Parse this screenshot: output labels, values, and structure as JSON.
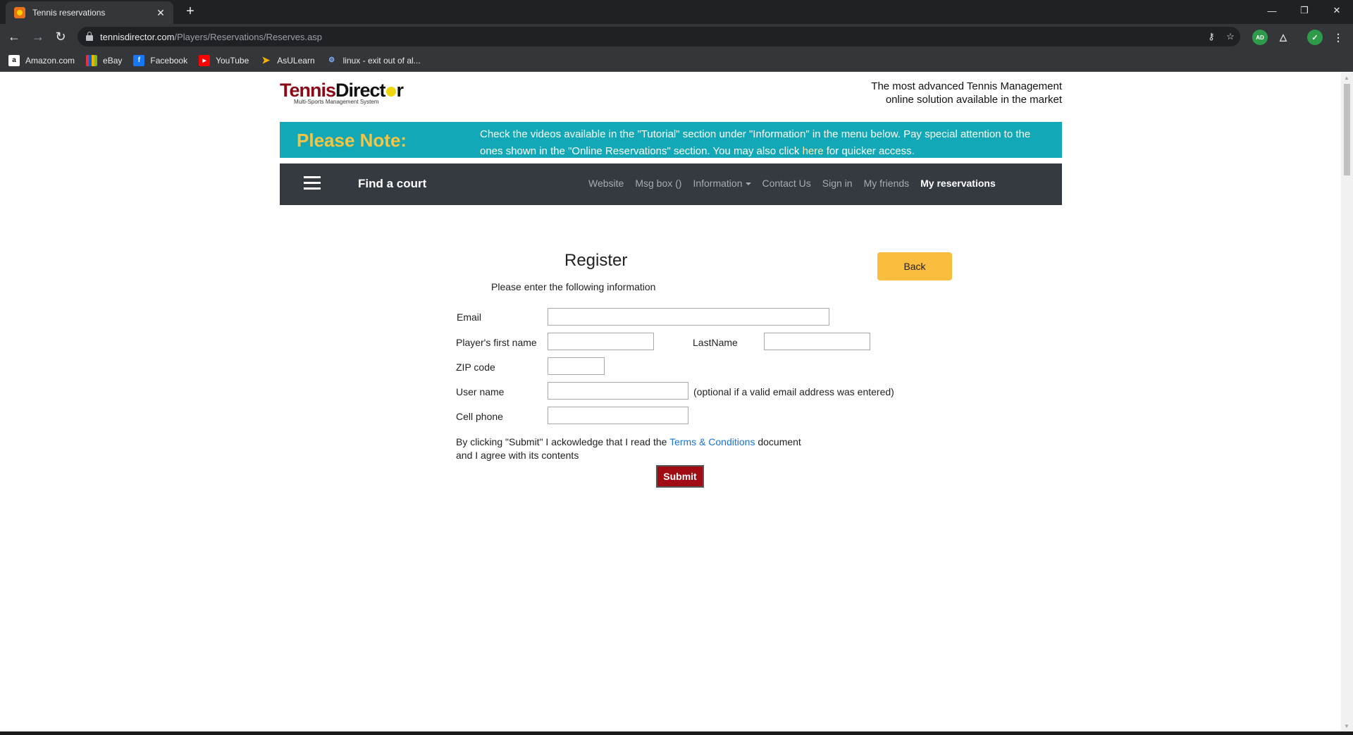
{
  "browser": {
    "tab_title": "Tennis reservations",
    "new_tab": "+",
    "url_domain": "tennisdirector.com",
    "url_path": "/Players/Reservations/Reserves.asp",
    "extension_ad": "AD",
    "bookmarks": [
      {
        "label": "Amazon.com",
        "icon": "amazon-icon"
      },
      {
        "label": "eBay",
        "icon": "ebay-icon"
      },
      {
        "label": "Facebook",
        "icon": "facebook-icon"
      },
      {
        "label": "YouTube",
        "icon": "youtube-icon"
      },
      {
        "label": "AsULearn",
        "icon": "asulearn-icon"
      },
      {
        "label": "linux - exit out of al...",
        "icon": "linux-icon"
      }
    ]
  },
  "header": {
    "logo_text_red": "Tennis",
    "logo_text_black": "Direct",
    "logo_text_end": "r",
    "logo_sub": "Multi-Sports Management System",
    "tagline_line1": "The most advanced Tennis Management",
    "tagline_line2": "online solution available in the market"
  },
  "notice": {
    "title": "Please Note:",
    "text_before": "Check the videos available in the \"Tutorial\" section under \"Information\" in the menu below. Pay special attention to the ones shown in the \"Online Reservations\" section. You may also click ",
    "link": "here",
    "text_after": " for quicker access."
  },
  "navbar": {
    "brand": "Find a court",
    "links": [
      "Website",
      "Msg box ()",
      "Information",
      "Contact Us",
      "Sign in",
      "My friends",
      "My reservations"
    ]
  },
  "form": {
    "title": "Register",
    "back_label": "Back",
    "instruction": "Please enter the following information",
    "email_label": "Email",
    "first_name_label": "Player's first name",
    "last_name_label": "LastName",
    "zip_label": "ZIP code",
    "username_label": "User name",
    "username_note": "(optional if a valid email address was entered)",
    "cell_label": "Cell phone",
    "email_value": "",
    "first_name_value": "",
    "last_name_value": "",
    "zip_value": "",
    "username_value": "",
    "cell_value": "",
    "terms_before": "By clicking \"Submit\" I ackowledge that I read the ",
    "terms_link": "Terms & Conditions",
    "terms_after": " document",
    "terms_line2": "and I agree with its contents",
    "submit_label": "Submit"
  }
}
